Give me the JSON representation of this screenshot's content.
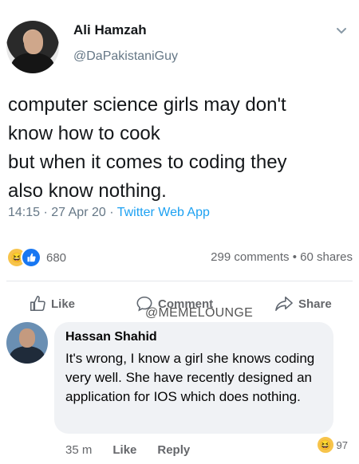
{
  "tweet": {
    "name": "Ali Hamzah",
    "handle": "@DaPakistaniGuy",
    "text": "computer science girls may don't\nknow how to cook\nbut when it comes to coding they\nalso know nothing.",
    "time": "14:15 · 27 Apr 20 · ",
    "source": "Twitter Web App",
    "chevron_icon": "chevron-down-icon"
  },
  "post": {
    "reaction_count": "680",
    "comments_shares": "299 comments • 60 shares",
    "actions": {
      "like": "Like",
      "comment": "Comment",
      "share": "Share"
    },
    "watermark": "@MEMELOUNGE",
    "accent": "#1877f2"
  },
  "comment": {
    "name": "Hassan Shahid",
    "text": "It's wrong, I know a girl she knows coding very well. She have recently designed an application for IOS which does nothing.",
    "time": "35 m",
    "like": "Like",
    "reply": "Reply",
    "reaction_count": "97"
  }
}
